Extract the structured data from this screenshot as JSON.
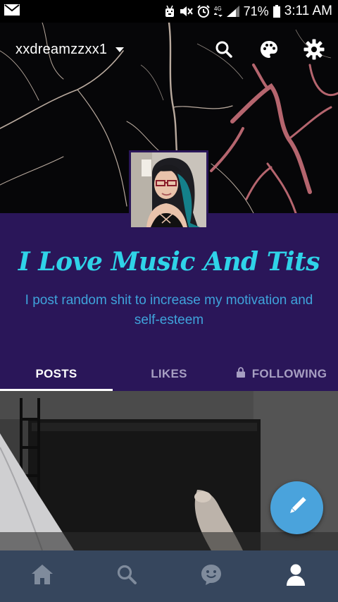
{
  "status_bar": {
    "battery": "71%",
    "time": "3:11 AM",
    "icons": [
      "mail-icon",
      "android-debug-icon",
      "mute-icon",
      "alarm-icon",
      "data-icon",
      "signal-icon",
      "battery-icon"
    ]
  },
  "topbar": {
    "blog_name": "xxdreamzzxx1",
    "icons": [
      "search-icon",
      "palette-icon",
      "gear-icon"
    ]
  },
  "profile": {
    "title": "I Love Music And Tits",
    "description": "I post random shit to increase my motivation and self-esteem"
  },
  "tabs": [
    {
      "label": "POSTS",
      "active": true
    },
    {
      "label": "LIKES",
      "active": false
    },
    {
      "label": "FOLLOWING",
      "active": false,
      "icon": "lock-icon"
    }
  ],
  "fab": {
    "icon": "pencil-icon"
  },
  "bottom_nav": {
    "items": [
      "home-icon",
      "search-icon",
      "smiley-icon",
      "account-icon"
    ],
    "active": "account-icon"
  },
  "colors": {
    "header_purple": "#2a1659",
    "title_cyan": "#2fd3e8",
    "description_blue": "#3fa3db",
    "fab_blue": "#4aa3dc",
    "nav_bg": "#36465d"
  }
}
